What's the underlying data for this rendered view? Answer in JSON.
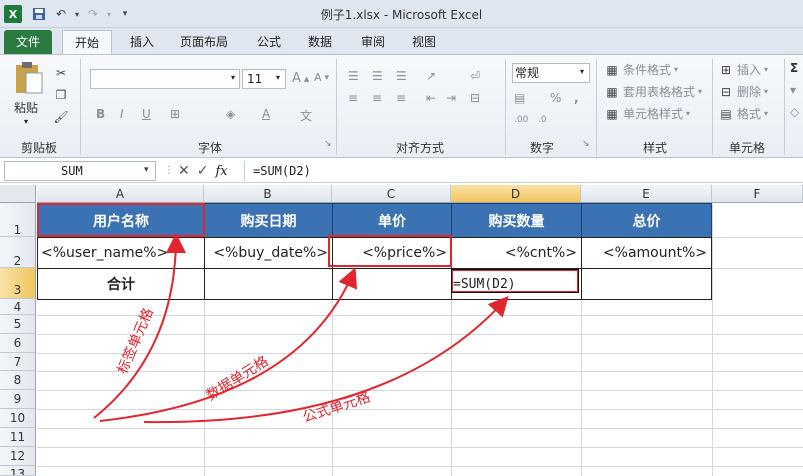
{
  "window": {
    "title": "例子1.xlsx - Microsoft Excel",
    "app_icon": "X"
  },
  "quick_access": {
    "save": "save-icon",
    "undo": "undo-icon",
    "redo": "redo-icon"
  },
  "tabs": [
    {
      "label": "文件"
    },
    {
      "label": "开始"
    },
    {
      "label": "插入"
    },
    {
      "label": "页面布局"
    },
    {
      "label": "公式"
    },
    {
      "label": "数据"
    },
    {
      "label": "审阅"
    },
    {
      "label": "视图"
    }
  ],
  "ribbon": {
    "clipboard": {
      "paste_label": "粘贴",
      "group_label": "剪贴板"
    },
    "font": {
      "font_name": "",
      "font_size": "11",
      "group_label": "字体"
    },
    "alignment": {
      "group_label": "对齐方式"
    },
    "number": {
      "format": "常规",
      "group_label": "数字"
    },
    "styles": {
      "conditional": "条件格式",
      "table_format": "套用表格格式",
      "cell_styles": "单元格样式",
      "group_label": "样式"
    },
    "cells": {
      "insert": "插入",
      "delete": "删除",
      "format": "格式",
      "group_label": "单元格"
    }
  },
  "formula_bar": {
    "name_box": "SUM",
    "formula": "=SUM(D2)"
  },
  "columns": [
    "A",
    "B",
    "C",
    "D",
    "E",
    "F"
  ],
  "rows": [
    "1",
    "2",
    "3",
    "4",
    "5",
    "6",
    "7",
    "8",
    "9",
    "10",
    "11",
    "12",
    "13"
  ],
  "table": {
    "headers": [
      "用户名称",
      "购买日期",
      "单价",
      "购买数量",
      "总价"
    ],
    "row2": [
      "<%user_name%>",
      "<%buy_date%>",
      "<%price%>",
      "<%cnt%>",
      "<%amount%>"
    ],
    "row3": [
      "合计",
      "",
      "",
      "=SUM(D2)",
      ""
    ]
  },
  "annotations": {
    "label_cell": "标签单元格",
    "data_cell": "数据单元格",
    "formula_cell": "公式单元格"
  },
  "colors": {
    "header_fill": "#3b72b3",
    "annotation_red": "#e0262f",
    "file_tab": "#2a7b3f"
  }
}
